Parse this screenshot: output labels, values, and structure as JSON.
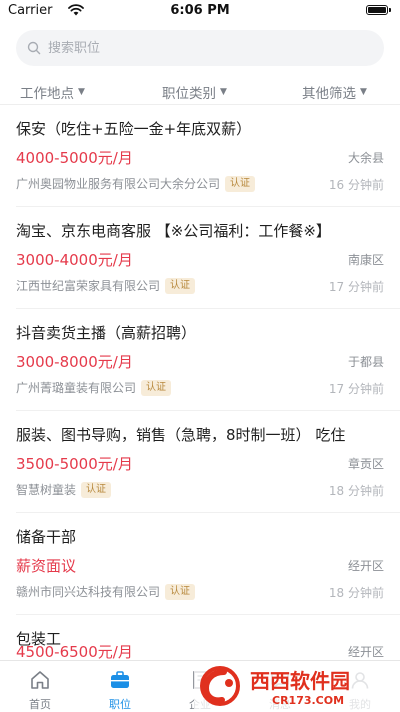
{
  "status_bar": {
    "carrier": "Carrier",
    "time": "6:06 PM"
  },
  "search": {
    "placeholder": "搜索职位"
  },
  "filters": {
    "location": "工作地点",
    "category": "职位类别",
    "other": "其他筛选"
  },
  "jobs": [
    {
      "title": "保安（吃住+五险一金+年底双薪）",
      "salary": "4000-5000元/月",
      "location": "大余县",
      "company": "广州奥园物业服务有限公司大余分公司",
      "badge": "认证",
      "time": "16 分钟前"
    },
    {
      "title": "淘宝、京东电商客服 【※公司福利：工作餐※】",
      "salary": "3000-4000元/月",
      "location": "南康区",
      "company": "江西世纪富荣家具有限公司",
      "badge": "认证",
      "time": "17 分钟前"
    },
    {
      "title": "抖音卖货主播（高薪招聘）",
      "salary": "3000-8000元/月",
      "location": "于都县",
      "company": "广州菁璐童装有限公司",
      "badge": "认证",
      "time": "17 分钟前"
    },
    {
      "title": "服装、图书导购，销售（急聘，8时制一班） 吃住",
      "salary": "3500-5000元/月",
      "location": "章贡区",
      "company": "智慧树童装",
      "badge": "认证",
      "time": "18 分钟前"
    },
    {
      "title": "储备干部",
      "salary": "薪资面议",
      "location": "经开区",
      "company": "赣州市同兴达科技有限公司",
      "badge": "认证",
      "time": "18 分钟前"
    },
    {
      "title": "包装工",
      "salary": "4500-6500元/月",
      "location": "经开区",
      "company": "",
      "badge": "",
      "time": ""
    }
  ],
  "tabs": [
    {
      "label": "首页",
      "icon": "home-icon",
      "active": false
    },
    {
      "label": "职位",
      "icon": "briefcase-icon",
      "active": true
    },
    {
      "label": "企业",
      "icon": "building-icon",
      "active": false
    },
    {
      "label": "消息",
      "icon": "message-icon",
      "active": false
    },
    {
      "label": "我的",
      "icon": "profile-icon",
      "active": false
    }
  ],
  "watermark": {
    "brand": "西西软件园",
    "url": "CR173.COM"
  },
  "colors": {
    "accent": "#1b8fe6",
    "salary": "#e53a4b",
    "badge_text": "#b8893d",
    "badge_bg": "#f7ecd9",
    "watermark": "#e0301e"
  }
}
